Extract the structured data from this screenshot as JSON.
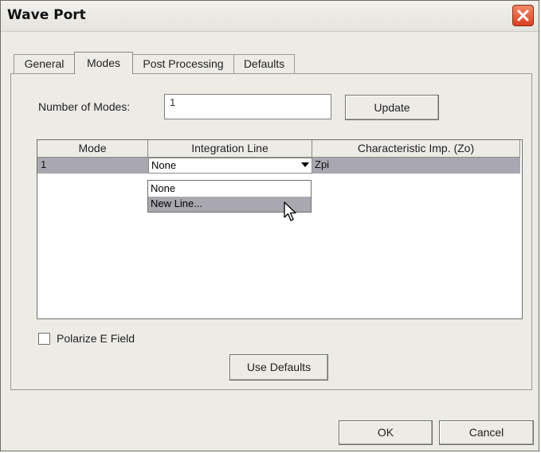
{
  "window": {
    "title": "Wave Port"
  },
  "tabs": [
    {
      "label": "General",
      "active": false
    },
    {
      "label": "Modes",
      "active": true
    },
    {
      "label": "Post Processing",
      "active": false
    },
    {
      "label": "Defaults",
      "active": false
    }
  ],
  "modes_tab": {
    "number_of_modes_label": "Number of Modes:",
    "number_of_modes_value": "1",
    "update_button": "Update",
    "table": {
      "columns": [
        "Mode",
        "Integration Line",
        "Characteristic Imp. (Zo)"
      ],
      "rows": [
        {
          "mode": "1",
          "integration_line": "None",
          "characteristic_imp": "Zpi"
        }
      ]
    },
    "integration_line_options": [
      "None",
      "New Line..."
    ],
    "highlighted_option": "New Line...",
    "polarize_label": "Polarize E Field",
    "polarize_checked": false,
    "use_defaults_button": "Use Defaults"
  },
  "footer": {
    "ok_button": "OK",
    "cancel_button": "Cancel"
  },
  "colors": {
    "dialog_bg": "#ecebe6",
    "selection_bg": "#a9a8b0",
    "close_button": "#d9401f"
  },
  "icons": [
    "close-icon",
    "dropdown-arrow-icon",
    "mouse-cursor-icon"
  ]
}
